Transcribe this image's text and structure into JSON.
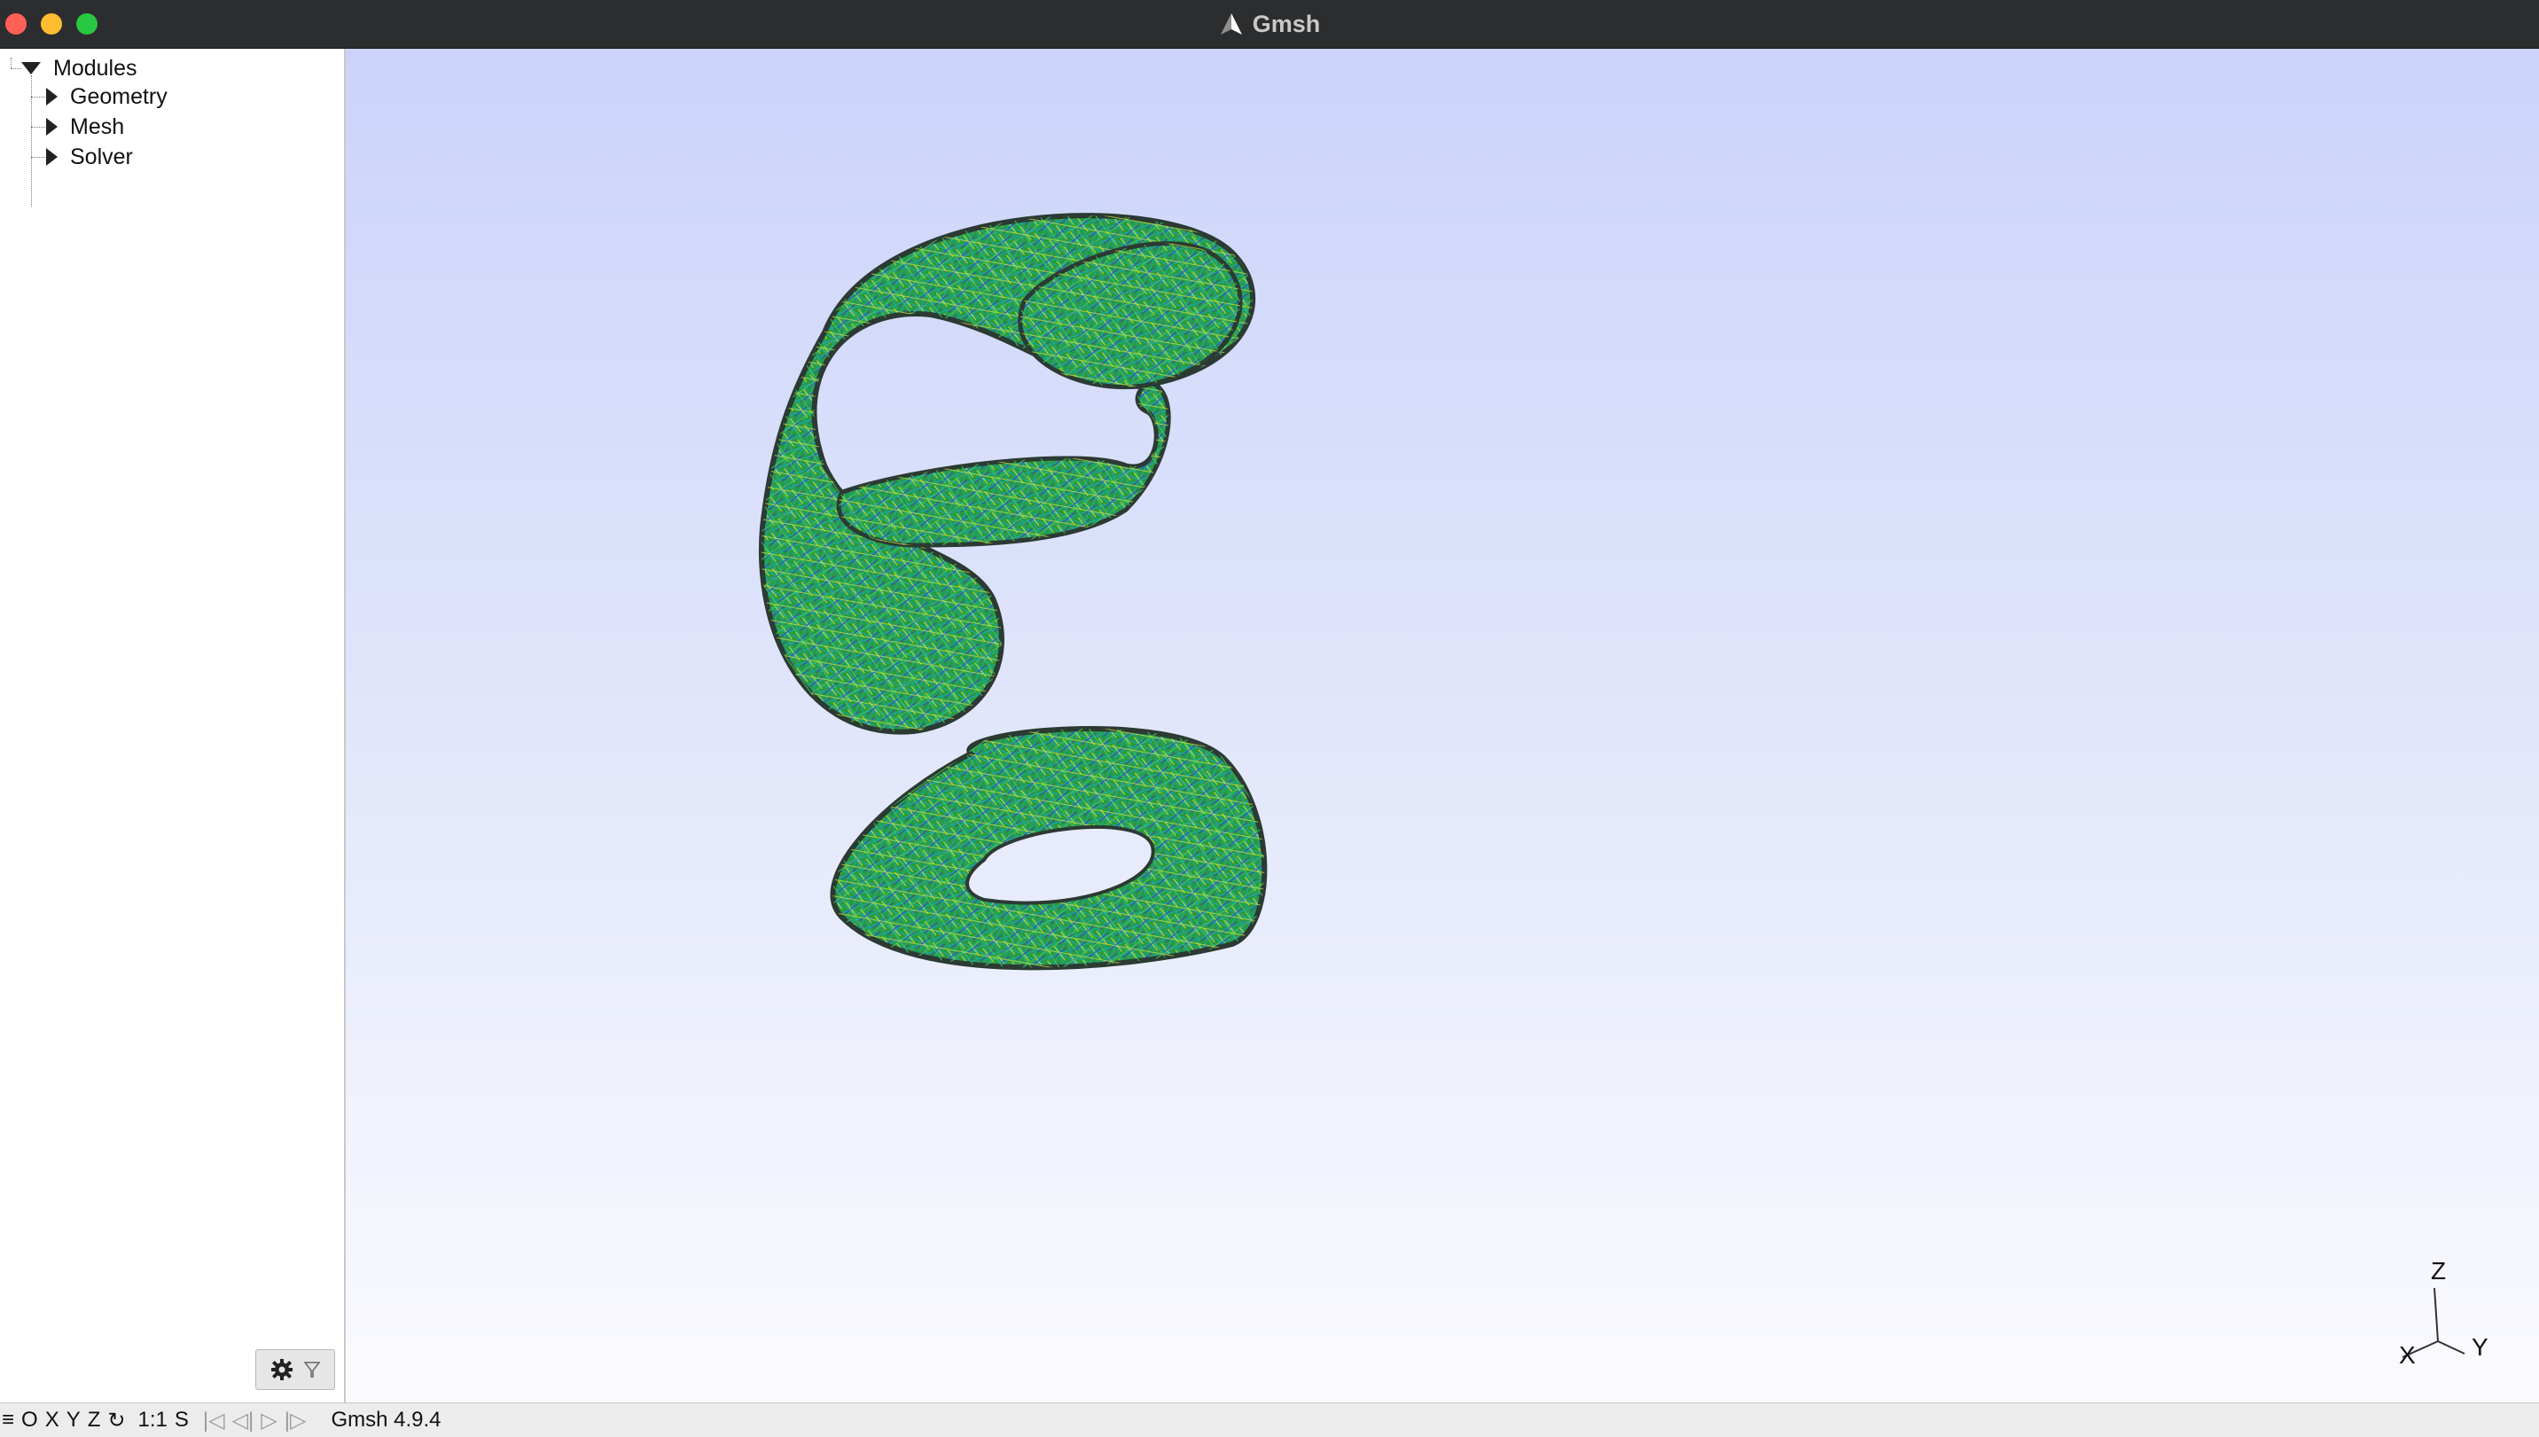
{
  "window": {
    "title": "Gmsh",
    "colors": {
      "close": "#ff5f57",
      "minimize": "#febc2e",
      "maximize": "#28c840"
    }
  },
  "sidebar": {
    "root_label": "Modules",
    "items": [
      {
        "label": "Geometry"
      },
      {
        "label": "Mesh"
      },
      {
        "label": "Solver"
      }
    ]
  },
  "viewport": {
    "axes": {
      "x": "X",
      "y": "Y",
      "z": "Z"
    },
    "model": "mesh-3d-model",
    "colors": {
      "mesh_green": "#2fae3a",
      "mesh_teal": "#19a7a0",
      "mesh_blue": "#3a4fb3",
      "mesh_yellow": "#d8e03a"
    }
  },
  "statusbar": {
    "menu_glyph": "≡",
    "o": "O",
    "x": "X",
    "y": "Y",
    "z": "Z",
    "rotate_glyph": "↻",
    "scale": "1:1",
    "s": "S",
    "first_glyph": "|◁",
    "prev_glyph": "◁|",
    "play_glyph": "▷",
    "next_glyph": "|▷",
    "version": "Gmsh 4.9.4"
  }
}
